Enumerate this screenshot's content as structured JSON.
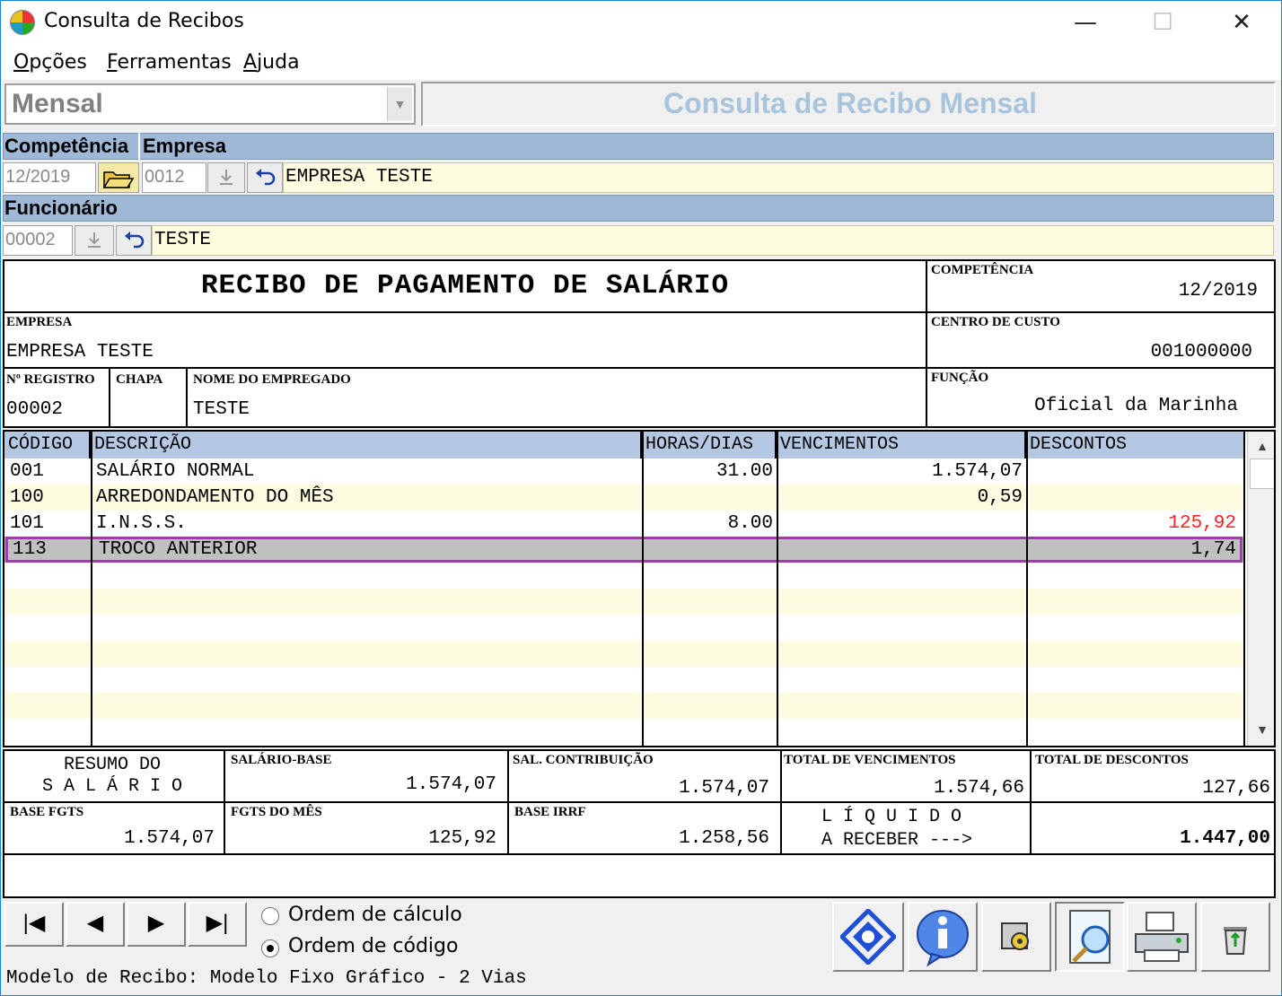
{
  "window": {
    "title": "Consulta de Recibos",
    "min": "—",
    "max": "☐",
    "close": "✕"
  },
  "menu": [
    {
      "hot": "O",
      "rest": "pções"
    },
    {
      "hot": "F",
      "rest": "erramentas"
    },
    {
      "hot": "A",
      "rest": "juda"
    }
  ],
  "type_select": {
    "value": "Mensal",
    "arrow": "▼"
  },
  "screen_title": "Consulta de Recibo Mensal",
  "filters": {
    "competencia_label": "Competência",
    "empresa_label": "Empresa",
    "competencia_value": "12/2019",
    "empresa_code": "0012",
    "empresa_name": "EMPRESA TESTE",
    "funcionario_label": "Funcionário",
    "funcionario_code": "00002",
    "funcionario_name": "TESTE"
  },
  "receipt": {
    "title": "RECIBO DE PAGAMENTO DE SALÁRIO",
    "competencia_label": "COMPETÊNCIA",
    "competencia_value": "12/2019",
    "empresa_label": "EMPRESA",
    "empresa_value": "EMPRESA TESTE",
    "centro_label": "CENTRO DE CUSTO",
    "centro_value": "001000000",
    "registro_label": "Nº REGISTRO",
    "registro_value": "00002",
    "chapa_label": "CHAPA",
    "chapa_value": "",
    "nome_label": "NOME DO EMPREGADO",
    "nome_value": "TESTE",
    "funcao_label": "FUNÇÃO",
    "funcao_value": "Oficial da Marinha"
  },
  "grid": {
    "headers": [
      "CÓDIGO",
      "DESCRIÇÃO",
      "HORAS/DIAS",
      "VENCIMENTOS",
      "DESCONTOS"
    ],
    "rows": [
      {
        "codigo": "001",
        "descricao": "SALÁRIO NORMAL",
        "horas": "31.00",
        "venc": "1.574,07",
        "desc": ""
      },
      {
        "codigo": "100",
        "descricao": "ARREDONDAMENTO DO MÊS",
        "horas": "",
        "venc": "0,59",
        "desc": ""
      },
      {
        "codigo": "101",
        "descricao": "I.N.S.S.",
        "horas": "8.00",
        "venc": "",
        "desc": "125,92"
      },
      {
        "codigo": "113",
        "descricao": "TROCO ANTERIOR",
        "horas": "",
        "venc": "",
        "desc": "1,74"
      }
    ],
    "scroll_up": "▲",
    "scroll_down": "▼"
  },
  "summary": {
    "resumo_line1": "RESUMO DO",
    "resumo_line2": "S A L Á R I O",
    "salario_base_label": "SALÁRIO-BASE",
    "salario_base_value": "1.574,07",
    "sal_contrib_label": "SAL. CONTRIBUIÇÃO",
    "sal_contrib_value": "1.574,07",
    "total_venc_label": "TOTAL DE VENCIMENTOS",
    "total_venc_value": "1.574,66",
    "total_desc_label": "TOTAL DE DESCONTOS",
    "total_desc_value": "127,66",
    "base_fgts_label": "BASE FGTS",
    "base_fgts_value": "1.574,07",
    "fgts_mes_label": "FGTS DO MÊS",
    "fgts_mes_value": "125,92",
    "base_irrf_label": "BASE IRRF",
    "base_irrf_value": "1.258,56",
    "liquido_line1": "L Í Q U I D O",
    "liquido_line2": "A RECEBER --->",
    "liquido_value": "1.447,00"
  },
  "nav": {
    "first": "|◀",
    "prev": "◀",
    "next": "▶",
    "last": "▶|"
  },
  "order": {
    "calc_label": "Ordem de cálculo",
    "code_label": "Ordem de código",
    "selected": "code"
  },
  "status": "Modelo de Recibo: Modelo Fixo Gráfico - 2 Vias",
  "colors": {
    "header_band": "#9fb8d6",
    "row_alt": "#fdfbe0",
    "row_selected": "#c0c0c0",
    "selection_border": "#9a3fa6",
    "negative": "#ff2020",
    "title_text": "#a8c4dc"
  }
}
